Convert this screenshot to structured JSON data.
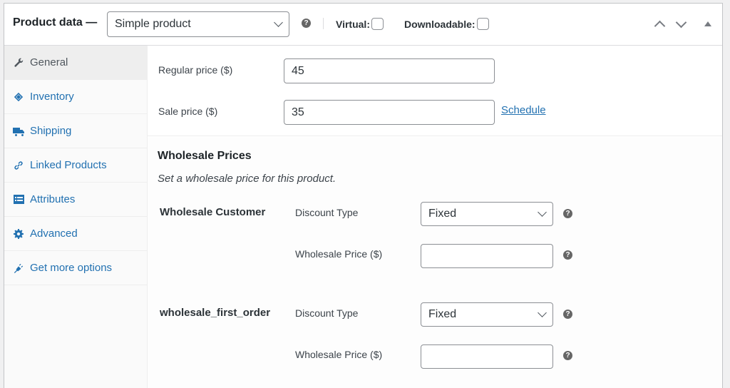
{
  "header": {
    "title": "Product data —",
    "product_type": "Simple product",
    "virtual_label": "Virtual:",
    "virtual_checked": false,
    "downloadable_label": "Downloadable:",
    "downloadable_checked": false,
    "help_icon": "?"
  },
  "sidebar": {
    "items": [
      {
        "label": "General",
        "icon": "wrench-icon",
        "active": true
      },
      {
        "label": "Inventory",
        "icon": "tag-icon",
        "active": false
      },
      {
        "label": "Shipping",
        "icon": "truck-icon",
        "active": false
      },
      {
        "label": "Linked Products",
        "icon": "link-icon",
        "active": false
      },
      {
        "label": "Attributes",
        "icon": "list-card-icon",
        "active": false
      },
      {
        "label": "Advanced",
        "icon": "gear-icon",
        "active": false
      },
      {
        "label": "Get more options",
        "icon": "plug-icon",
        "active": false
      }
    ]
  },
  "general": {
    "regular_price_label": "Regular price ($)",
    "regular_price_value": "45",
    "sale_price_label": "Sale price ($)",
    "sale_price_value": "35",
    "schedule_link": "Schedule"
  },
  "wholesale": {
    "title": "Wholesale Prices",
    "description": "Set a wholesale price for this product.",
    "roles": [
      {
        "name": "Wholesale Customer",
        "discount_type_label": "Discount Type",
        "discount_type_value": "Fixed",
        "price_label": "Wholesale Price ($)",
        "price_value": ""
      },
      {
        "name": "wholesale_first_order",
        "discount_type_label": "Discount Type",
        "discount_type_value": "Fixed",
        "price_label": "Wholesale Price ($)",
        "price_value": ""
      }
    ]
  },
  "colors": {
    "link": "#2271b1",
    "border": "#8c8f94",
    "page_bg": "#f0f0f1"
  }
}
